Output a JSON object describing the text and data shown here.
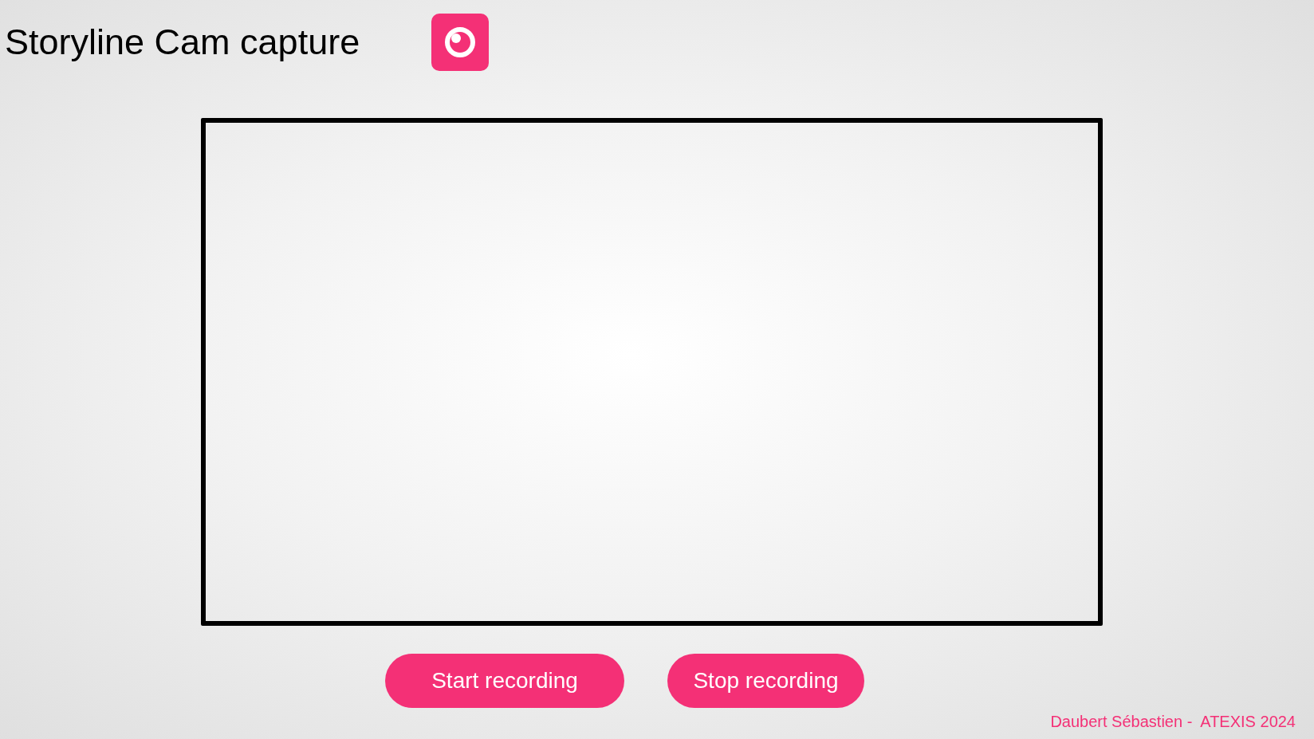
{
  "title": "Storyline Cam capture",
  "buttons": [
    {
      "label": "Start recording"
    },
    {
      "label": "Stop recording"
    }
  ],
  "footer": "Daubert Sébastien -  ATEXIS 2024"
}
